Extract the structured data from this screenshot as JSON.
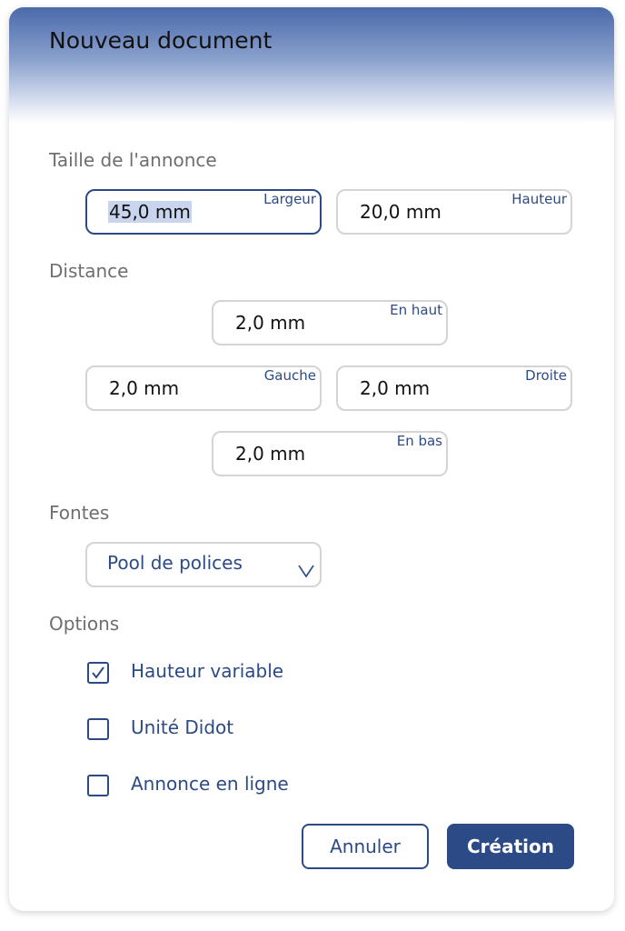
{
  "dialog": {
    "title": "Nouveau document"
  },
  "size_section": {
    "label": "Taille de l'annonce",
    "width": {
      "value": "45,0 mm",
      "label": "Largeur"
    },
    "height": {
      "value": "20,0 mm",
      "label": "Hauteur"
    }
  },
  "distance_section": {
    "label": "Distance",
    "top": {
      "value": "2,0 mm",
      "label": "En haut"
    },
    "left": {
      "value": "2,0 mm",
      "label": "Gauche"
    },
    "right": {
      "value": "2,0 mm",
      "label": "Droite"
    },
    "bottom": {
      "value": "2,0 mm",
      "label": "En bas"
    }
  },
  "fonts_section": {
    "label": "Fontes",
    "selected": "Pool de polices",
    "chevron_icon": "chevron-down-icon"
  },
  "options_section": {
    "label": "Options",
    "items": [
      {
        "label": "Hauteur variable",
        "checked": true
      },
      {
        "label": "Unité Didot",
        "checked": false
      },
      {
        "label": "Annonce en ligne",
        "checked": false
      }
    ]
  },
  "buttons": {
    "cancel": "Annuler",
    "create": "Création"
  },
  "colors": {
    "accent": "#2c4a86",
    "header_top": "#4b6aab",
    "section_label": "#6e6e6e",
    "field_border": "#d4d4d4"
  }
}
